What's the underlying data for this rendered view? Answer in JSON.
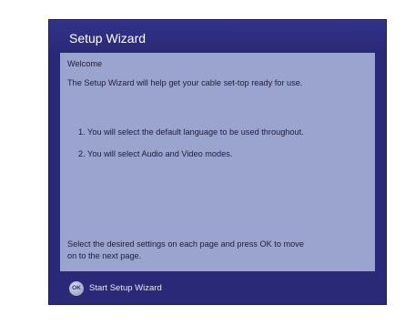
{
  "window": {
    "title": "Setup Wizard"
  },
  "content": {
    "heading": "Welcome",
    "intro": "The Setup Wizard will help get your cable set-top ready for use.",
    "steps": [
      "1. You will select the default language to be used throughout.",
      "2. You will select Audio and Video modes."
    ],
    "instruction_line1": "Select the desired settings on each page and press OK to move",
    "instruction_line2": "on to the next page."
  },
  "footer": {
    "ok_icon_label": "OK",
    "start_label": "Start Setup Wizard"
  },
  "colors": {
    "frame": "#2a2978",
    "content_panel": "#9ba4cf",
    "title_text": "#ffffff",
    "body_text": "#1d1d3a"
  },
  "icons": {
    "ok": "ok-button-icon"
  }
}
